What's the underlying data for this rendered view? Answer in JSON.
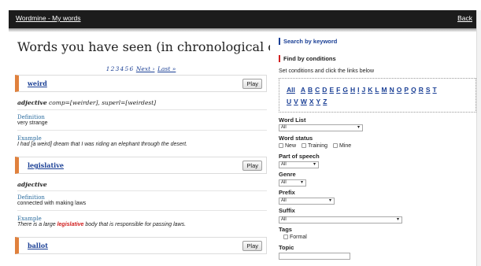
{
  "header": {
    "brand": "Wordmine - My words",
    "back": "Back"
  },
  "main": {
    "title": "Words you have seen (in chronological order)",
    "pages": [
      "1",
      "2",
      "3",
      "4",
      "5",
      "6"
    ],
    "next": "Next ›",
    "last": "Last »"
  },
  "words": [
    {
      "word": "weird",
      "play": "Play",
      "pos": "adjective",
      "forms": "comp=[weirder], superl=[weirdest]",
      "def_label": "Definition",
      "definition": "very strange",
      "ex_label": "Example",
      "example_pre": "I had [a weird] dream that I was riding an elephant through the desert.",
      "example_hl": "",
      "example_post": ""
    },
    {
      "word": "legislative",
      "play": "Play",
      "pos": "adjective",
      "forms": "",
      "def_label": "Definition",
      "definition": "connected with making laws",
      "ex_label": "Example",
      "example_pre": "There is a large ",
      "example_hl": "legislative",
      "example_post": " body that is responsible for passing laws."
    },
    {
      "word": "ballot",
      "play": "Play"
    }
  ],
  "sidebar": {
    "search_keyword": "Search by keyword",
    "find_conditions": "Find by conditions",
    "hint": "Set conditions and click the links below",
    "letters_row1": [
      "All",
      "A",
      "B",
      "C",
      "D",
      "E",
      "F",
      "G",
      "H",
      "I",
      "J",
      "K",
      "L",
      "M",
      "N",
      "O",
      "P",
      "Q",
      "R",
      "S",
      "T"
    ],
    "letters_row2": [
      "U",
      "V",
      "W",
      "X",
      "Y",
      "Z"
    ],
    "word_list": {
      "label": "Word List",
      "value": "All"
    },
    "word_status": {
      "label": "Word status",
      "options": [
        "New",
        "Training",
        "Mine"
      ]
    },
    "part_of_speech": {
      "label": "Part of speech",
      "value": "All"
    },
    "genre": {
      "label": "Genre",
      "value": "All"
    },
    "prefix": {
      "label": "Prefix",
      "value": "All"
    },
    "suffix": {
      "label": "Suffix",
      "value": "All"
    },
    "tags": {
      "label": "Tags",
      "options": [
        "Formal"
      ]
    },
    "topic": {
      "label": "Topic"
    }
  },
  "colors": {
    "accent_orange": "#e0813d",
    "link_blue": "#1a3f95",
    "highlight_red": "#d12020",
    "topbar": "#1c1c1c"
  }
}
